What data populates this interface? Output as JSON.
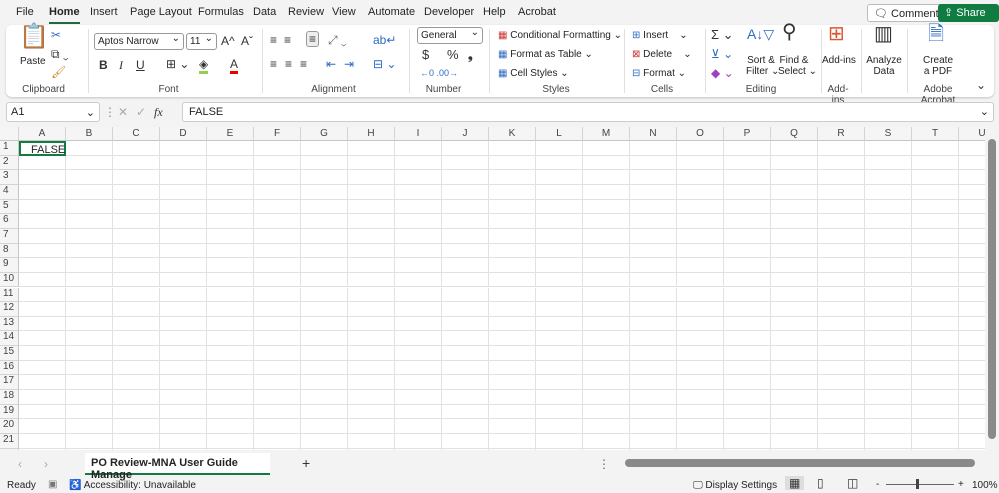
{
  "menu": {
    "tabs": [
      "File",
      "Home",
      "Insert",
      "Page Layout",
      "Formulas",
      "Data",
      "Review",
      "View",
      "Automate",
      "Developer",
      "Help",
      "Acrobat"
    ],
    "active": "Home",
    "comments": "Comments",
    "share": "Share"
  },
  "ribbon": {
    "clipboard": {
      "label": "Clipboard",
      "paste": "Paste"
    },
    "font": {
      "label": "Font",
      "name": "Aptos Narrow",
      "size": "11",
      "bold": "B",
      "italic": "I",
      "underline": "U",
      "grow": "A^",
      "shrink": "Aˇ"
    },
    "alignment": {
      "label": "Alignment"
    },
    "number": {
      "label": "Number",
      "format": "General",
      "currency": "$",
      "percent": "%",
      "comma": "❟"
    },
    "styles": {
      "label": "Styles",
      "conditional": "Conditional Formatting",
      "table": "Format as Table",
      "cell": "Cell Styles"
    },
    "cells": {
      "label": "Cells",
      "insert": "Insert",
      "delete": "Delete",
      "format": "Format"
    },
    "editing": {
      "label": "Editing",
      "sort": "Sort &",
      "sort2": "Filter",
      "find": "Find &",
      "find2": "Select",
      "sum": "Σ"
    },
    "addins": {
      "label": "Add-ins",
      "button": "Add-ins"
    },
    "analyze": {
      "line1": "Analyze",
      "line2": "Data"
    },
    "acrobat": {
      "label": "Adobe Acrobat",
      "line1": "Create",
      "line2": "a PDF"
    }
  },
  "formula": {
    "namebox": "A1",
    "fx": "fx",
    "value": "FALSE"
  },
  "grid": {
    "columns": [
      "A",
      "B",
      "C",
      "D",
      "E",
      "F",
      "G",
      "H",
      "I",
      "J",
      "K",
      "L",
      "M",
      "N",
      "O",
      "P",
      "Q",
      "R",
      "S",
      "T",
      "U"
    ],
    "rows": 21,
    "cells": {
      "A1": "FALSE"
    }
  },
  "sheets": {
    "tabs": [
      "PO Review-MNA User Guide Manage"
    ],
    "add": "+"
  },
  "status": {
    "ready": "Ready",
    "accessibility": "Accessibility: Unavailable",
    "display": "Display Settings",
    "zoom": "100%",
    "zoom_minus": "-",
    "zoom_plus": "+"
  }
}
